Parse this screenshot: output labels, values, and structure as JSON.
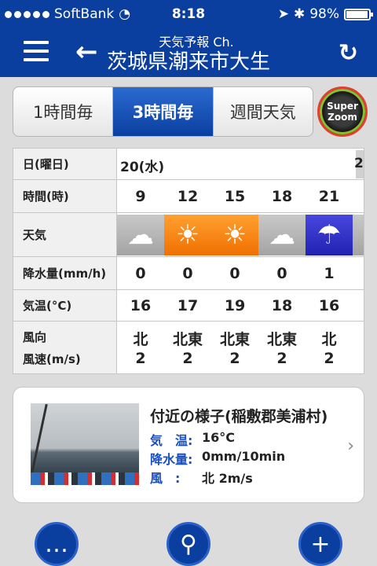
{
  "status": {
    "carrier": "SoftBank",
    "time": "8:18",
    "battery": "98%",
    "battery_level": 0.98
  },
  "header": {
    "subtitle": "天気予報 Ch.",
    "title": "茨城県潮来市大生"
  },
  "tabs": [
    {
      "label": "1時間毎",
      "active": false
    },
    {
      "label": "3時間毎",
      "active": true
    },
    {
      "label": "週間天気",
      "active": false
    }
  ],
  "superzoom": {
    "line1": "Super",
    "line2": "Zoom"
  },
  "table": {
    "labels": {
      "date": "日(曜日)",
      "hour": "時間(時)",
      "weather": "天気",
      "precip": "降水量(mm/h)",
      "temp": "気温(°C)",
      "wind1": "風向",
      "wind2": "風速(m/s)"
    },
    "date": "20(水)",
    "next_date": "2",
    "hours": [
      "9",
      "12",
      "15",
      "18",
      "21"
    ],
    "weather": [
      "cloudy",
      "sunny",
      "sunny",
      "cloudy",
      "rain"
    ],
    "precip": [
      "0",
      "0",
      "0",
      "0",
      "1"
    ],
    "temp": [
      "16",
      "17",
      "19",
      "18",
      "16"
    ],
    "wind_dir": [
      "北",
      "北東",
      "北東",
      "北東",
      "北"
    ],
    "wind_speed": [
      "2",
      "2",
      "2",
      "2",
      "2"
    ]
  },
  "nearby": {
    "place": "付近の様子(稲敷郡美浦村)",
    "temp_label": "気　温:",
    "temp_value": "16°C",
    "precip_label": "降水量:",
    "precip_value": "0mm/10min",
    "wind_label": "風　:",
    "wind_value": "北 2m/s"
  },
  "colors": {
    "brand": "#0a3fa0",
    "sunny": "#f07000",
    "rain": "#2020b0",
    "cloudy": "#a3a3a3"
  }
}
